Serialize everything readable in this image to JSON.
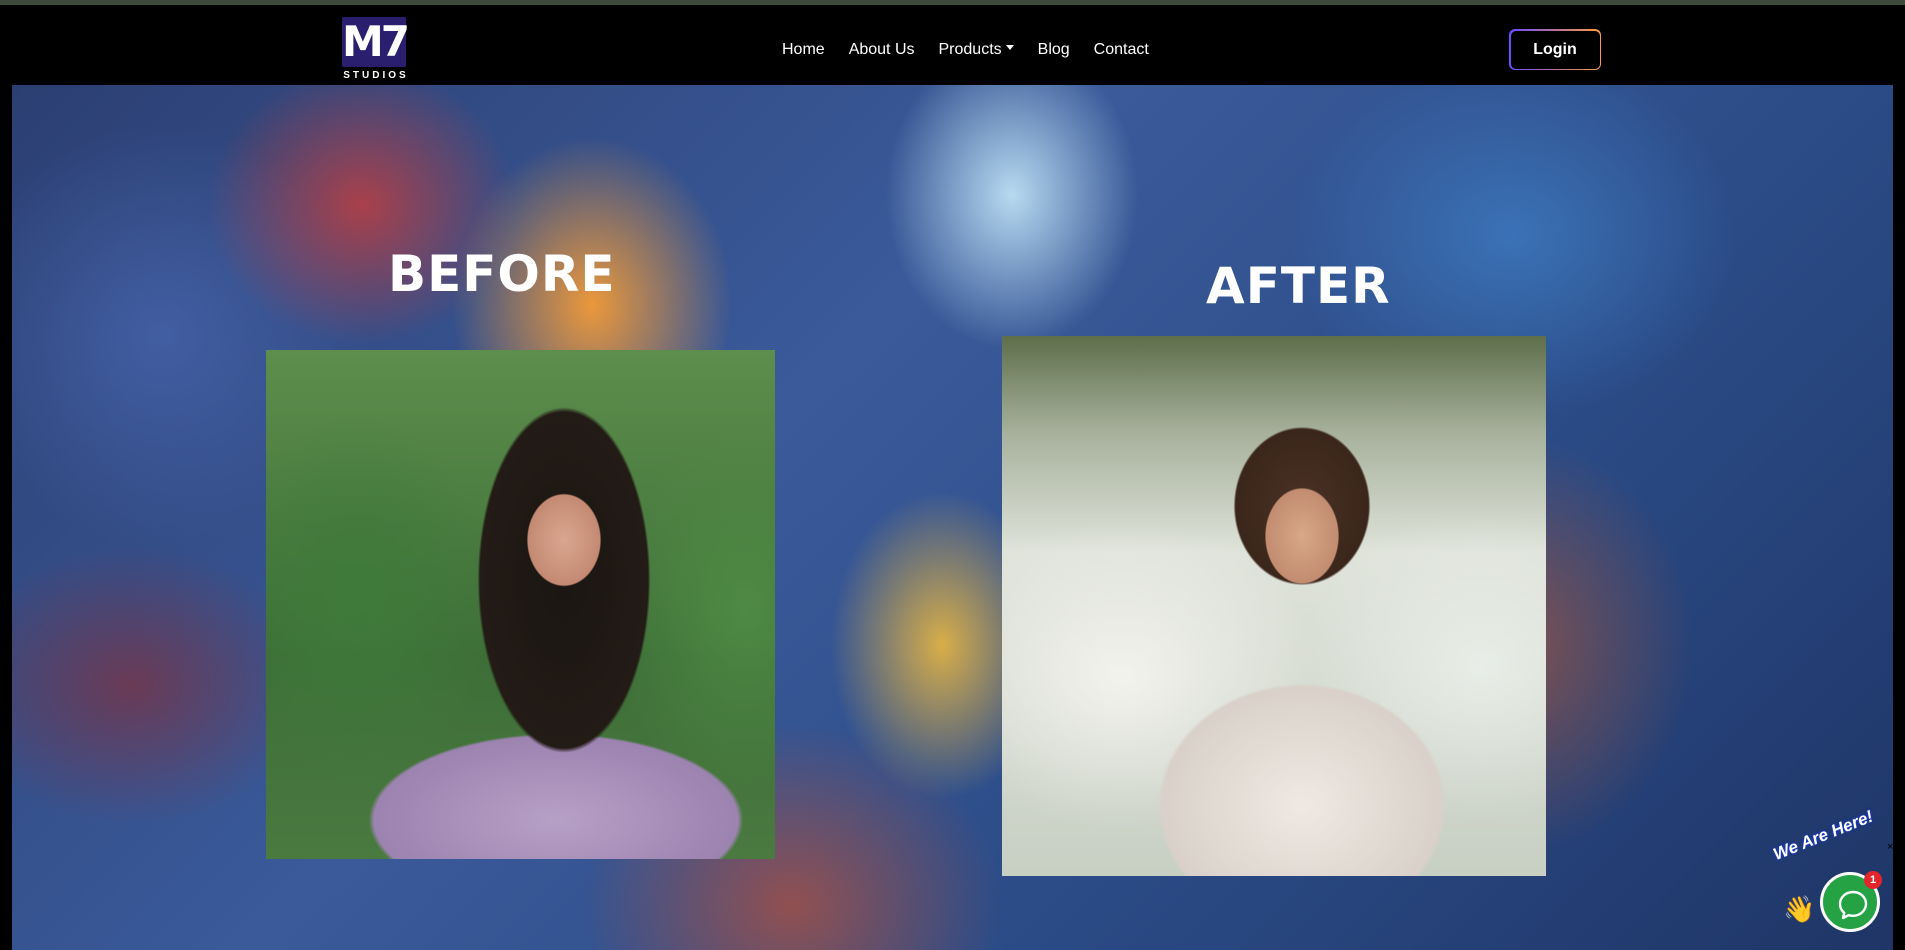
{
  "brand": {
    "logo_mark": "M7",
    "logo_sub": "STUDIOS"
  },
  "nav": {
    "items": [
      {
        "label": "Home"
      },
      {
        "label": "About Us"
      },
      {
        "label": "Products",
        "dropdown": true
      },
      {
        "label": "Blog"
      },
      {
        "label": "Contact"
      }
    ],
    "login_label": "Login"
  },
  "hero": {
    "before_label": "BEFORE",
    "after_label": "AFTER"
  },
  "chat": {
    "tagline": "We Are Here!",
    "badge_count": "1",
    "icons": [
      "chat-bubble-icon",
      "wave-hand-icon"
    ],
    "accent": "#25a244"
  },
  "colors": {
    "nav_bg": "#000000",
    "login_gradient_start": "#6a4cff",
    "login_gradient_end": "#ff9b3d",
    "badge": "#e2262c"
  }
}
